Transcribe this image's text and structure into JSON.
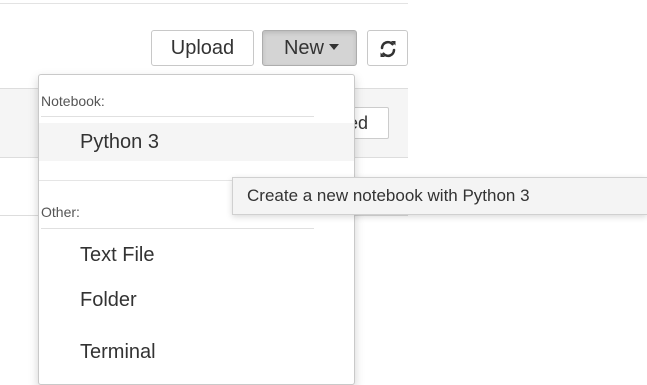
{
  "toolbar": {
    "upload_label": "Upload",
    "new_label": "New",
    "refresh_icon": "refresh-icon"
  },
  "list_header": {
    "partial_text": "ed"
  },
  "new_menu": {
    "notebook_section_label": "Notebook:",
    "notebook_items": [
      {
        "label": "Python 3",
        "active": true
      }
    ],
    "other_section_label": "Other:",
    "other_items": [
      {
        "label": "Text File"
      },
      {
        "label": "Folder"
      },
      {
        "label": "Terminal"
      }
    ]
  },
  "tooltip": {
    "text": "Create a new notebook with Python 3"
  },
  "colors": {
    "active_button_bg": "#d4d4d4",
    "menu_hover_bg": "#f5f5f5",
    "text": "#333333"
  }
}
